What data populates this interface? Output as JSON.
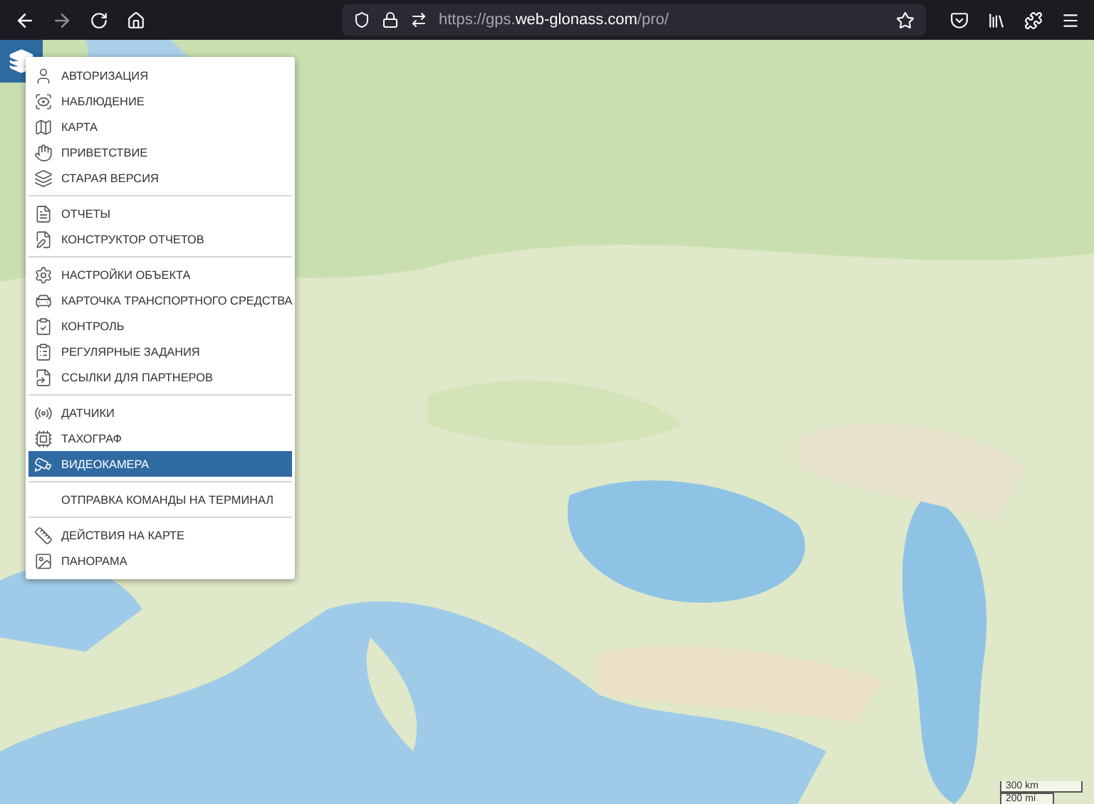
{
  "browser": {
    "url_prefix": "https://gps.",
    "url_domain": "web-glonass.com",
    "url_path": "/pro/"
  },
  "menu": {
    "groups": [
      [
        {
          "label": "АВТОРИЗАЦИЯ",
          "selected": false
        },
        {
          "label": "НАБЛЮДЕНИЕ",
          "selected": false
        },
        {
          "label": "КАРТА",
          "selected": false
        },
        {
          "label": "ПРИВЕТСТВИЕ",
          "selected": false
        },
        {
          "label": "СТАРАЯ ВЕРСИЯ",
          "selected": false
        }
      ],
      [
        {
          "label": "ОТЧЕТЫ",
          "selected": false
        },
        {
          "label": "КОНСТРУКТОР ОТЧЕТОВ",
          "selected": false
        }
      ],
      [
        {
          "label": "НАСТРОЙКИ ОБЪЕКТА",
          "selected": false
        },
        {
          "label": "КАРТОЧКА ТРАНСПОРТНОГО СРЕДСТВА",
          "selected": false
        },
        {
          "label": "КОНТРОЛЬ",
          "selected": false
        },
        {
          "label": "РЕГУЛЯРНЫЕ ЗАДАНИЯ",
          "selected": false
        },
        {
          "label": "ССЫЛКИ ДЛЯ ПАРТНЕРОВ",
          "selected": false
        }
      ],
      [
        {
          "label": "ДАТЧИКИ",
          "selected": false
        },
        {
          "label": "ТАХОГРАФ",
          "selected": false
        },
        {
          "label": "ВИДЕОКАМЕРА",
          "selected": true
        }
      ],
      [
        {
          "label": "ОТПРАВКА КОМАНДЫ НА ТЕРМИНАЛ",
          "selected": false
        }
      ],
      [
        {
          "label": "ДЕЙСТВИЯ НА КАРТЕ",
          "selected": false
        },
        {
          "label": "ПАНОРАМА",
          "selected": false
        }
      ]
    ]
  },
  "scale": {
    "metric": "300 km",
    "imperial": "200 mi"
  }
}
